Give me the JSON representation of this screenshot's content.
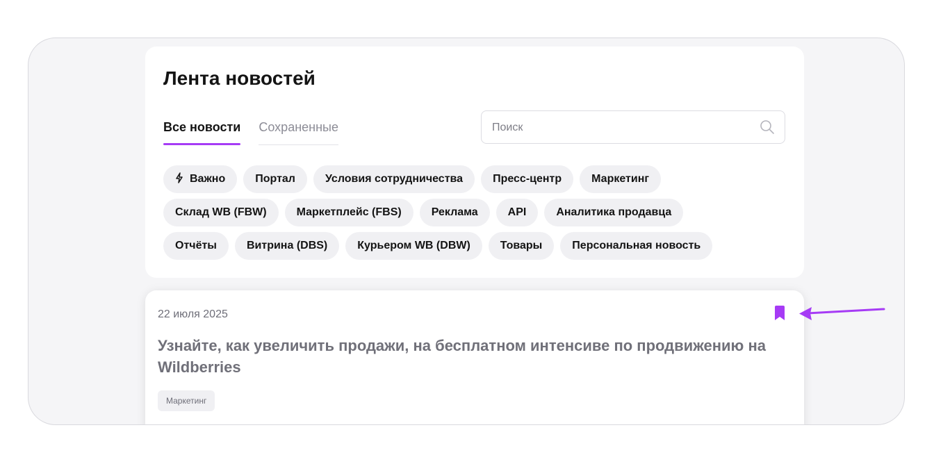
{
  "header": {
    "title": "Лента новостей"
  },
  "tabs": [
    {
      "label": "Все новости",
      "active": true
    },
    {
      "label": "Сохраненные",
      "active": false
    }
  ],
  "search": {
    "placeholder": "Поиск",
    "value": "",
    "icon": "search-icon"
  },
  "filters": {
    "rows": [
      [
        {
          "label": "Важно",
          "icon": "lightning-icon"
        },
        {
          "label": "Портал"
        },
        {
          "label": "Условия сотрудничества"
        },
        {
          "label": "Пресс-центр"
        },
        {
          "label": "Маркетинг"
        }
      ],
      [
        {
          "label": "Склад WB (FBW)"
        },
        {
          "label": "Маркетплейс (FBS)"
        },
        {
          "label": "Реклама"
        },
        {
          "label": "API"
        },
        {
          "label": "Аналитика продавца"
        }
      ],
      [
        {
          "label": "Отчёты"
        },
        {
          "label": "Витрина (DBS)"
        },
        {
          "label": "Курьером WB (DBW)"
        },
        {
          "label": "Товары"
        },
        {
          "label": "Персональная новость"
        }
      ]
    ]
  },
  "news": [
    {
      "date": "22 июля 2025",
      "title": "Узнайте, как увеличить продажи, на бесплатном интенсиве по продвижению на Wildberries",
      "tag": "Маркетинг",
      "saved": true,
      "bookmark_icon": "bookmark-icon"
    }
  ],
  "colors": {
    "accent": "#a63bf5",
    "chip_bg": "#f0f0f3",
    "frame_bg": "#f5f5f7",
    "annotation_arrow": "#a63bf5"
  },
  "annotation": {
    "icon": "arrow-left-icon"
  }
}
